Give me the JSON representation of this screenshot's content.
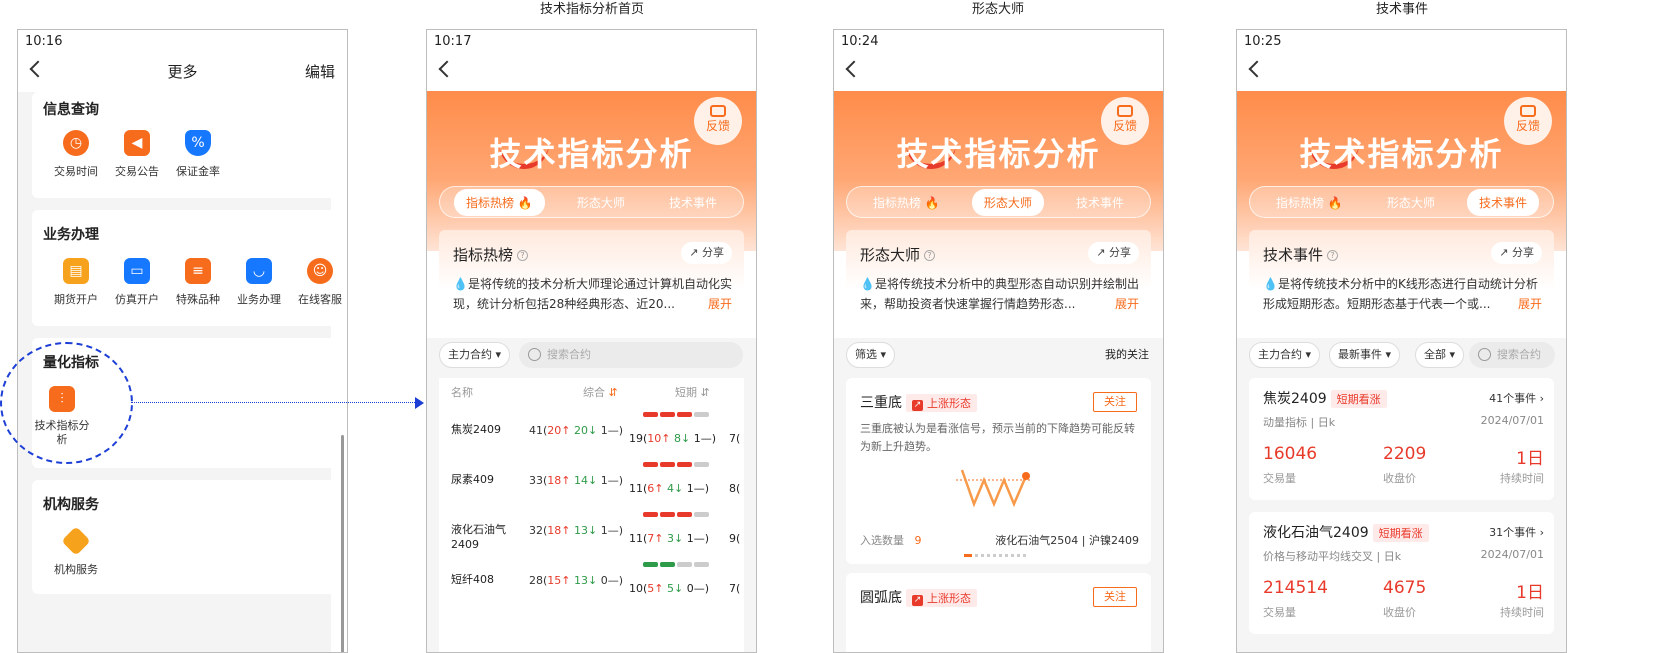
{
  "captions": [
    "技术指标分析首页",
    "形态大师",
    "技术事件"
  ],
  "phone1": {
    "time": "10:16",
    "title": "更多",
    "edit": "编辑",
    "sections": [
      {
        "title": "信息查询",
        "items": [
          {
            "label": "交易时间",
            "icon": "clock-icon",
            "color": "#f76b1c"
          },
          {
            "label": "交易公告",
            "icon": "megaphone-icon",
            "color": "#f76b1c"
          },
          {
            "label": "保证金率",
            "icon": "shield-percent-icon",
            "color": "#1677ff"
          }
        ]
      },
      {
        "title": "业务办理",
        "items": [
          {
            "label": "期货开户",
            "icon": "id-card-icon",
            "color": "#f7a21c"
          },
          {
            "label": "仿真开户",
            "icon": "simulation-icon",
            "color": "#1677ff"
          },
          {
            "label": "特殊品种",
            "icon": "lock-doc-icon",
            "color": "#f76b1c"
          },
          {
            "label": "业务办理",
            "icon": "bag-icon",
            "color": "#1677ff"
          },
          {
            "label": "在线客服",
            "icon": "headset-icon",
            "color": "#f76b1c"
          }
        ]
      },
      {
        "title": "量化指标",
        "items": [
          {
            "label": "技术指标分析",
            "icon": "indicator-icon",
            "color": "#f76b1c"
          }
        ]
      },
      {
        "title": "机构服务",
        "items": [
          {
            "label": "机构服务",
            "icon": "diamond-icon",
            "color": "#f7a21c"
          }
        ]
      }
    ]
  },
  "banner": {
    "title": "技术指标分析",
    "feedback": "反馈",
    "tabs": [
      "指标热榜",
      "形态大师",
      "技术事件"
    ],
    "share": "分享",
    "expand": "展开"
  },
  "phone2": {
    "time": "10:17",
    "intro_title": "指标热榜",
    "desc": "是将传统的技术分析大师理论通过计算机自动化实现，统计分析包括28种经典形态、近20...",
    "filter": "主力合约",
    "search_placeholder": "搜索合约",
    "cols": [
      "名称",
      "综合",
      "短期"
    ],
    "rows": [
      {
        "name": "焦炭2409",
        "total": "41",
        "up": "20",
        "down": "20",
        "flat": "1",
        "s_total": "19",
        "s_up": "10",
        "s_down": "8",
        "s_flat": "1",
        "next": "7"
      },
      {
        "name": "尿素409",
        "total": "33",
        "up": "18",
        "down": "14",
        "flat": "1",
        "s_total": "11",
        "s_up": "6",
        "s_down": "4",
        "s_flat": "1",
        "next": "8"
      },
      {
        "name": "液化石油气2409",
        "total": "32",
        "up": "18",
        "down": "13",
        "flat": "1",
        "s_total": "11",
        "s_up": "7",
        "s_down": "3",
        "s_flat": "1",
        "next": "9"
      },
      {
        "name": "短纤408",
        "total": "28",
        "up": "15",
        "down": "13",
        "flat": "0",
        "s_total": "10",
        "s_up": "5",
        "s_down": "5",
        "s_flat": "0",
        "next": "7"
      }
    ]
  },
  "phone3": {
    "time": "10:24",
    "intro_title": "形态大师",
    "desc": "是将传统技术分析中的典型形态自动识别并绘制出来，帮助投资者快速掌握行情趋势形态...",
    "filter": "筛选",
    "my_follow": "我的关注",
    "cards": [
      {
        "name": "三重底",
        "tag": "上涨形态",
        "follow": "关注",
        "desc": "三重底被认为是看涨信号，预示当前的下降趋势可能反转为新上升趋势。",
        "count_label": "入选数量",
        "count": "9",
        "contracts": [
          "液化石油气2504",
          "沪镍2409"
        ]
      },
      {
        "name": "圆弧底",
        "tag": "上涨形态",
        "follow": "关注"
      }
    ]
  },
  "phone4": {
    "time": "10:25",
    "intro_title": "技术事件",
    "desc": "是将传统技术分析中的K线形态进行自动统计分析形成短期形态。短期形态基于代表一个或...",
    "filters": [
      "主力合约",
      "最新事件",
      "全部"
    ],
    "search_placeholder": "搜索合约",
    "cards": [
      {
        "name": "焦炭2409",
        "tag": "短期看涨",
        "count": "41个事件",
        "sub": "动量指标 | 日k",
        "date": "2024/07/01",
        "vals": [
          "16046",
          "2209",
          "1日"
        ],
        "labels": [
          "交易量",
          "收盘价",
          "持续时间"
        ]
      },
      {
        "name": "液化石油气2409",
        "tag": "短期看涨",
        "count": "31个事件",
        "sub": "价格与移动平均线交叉 | 日k",
        "date": "2024/07/01",
        "vals": [
          "214514",
          "4675",
          "1日"
        ],
        "labels": [
          "交易量",
          "收盘价",
          "持续时间"
        ]
      }
    ]
  }
}
